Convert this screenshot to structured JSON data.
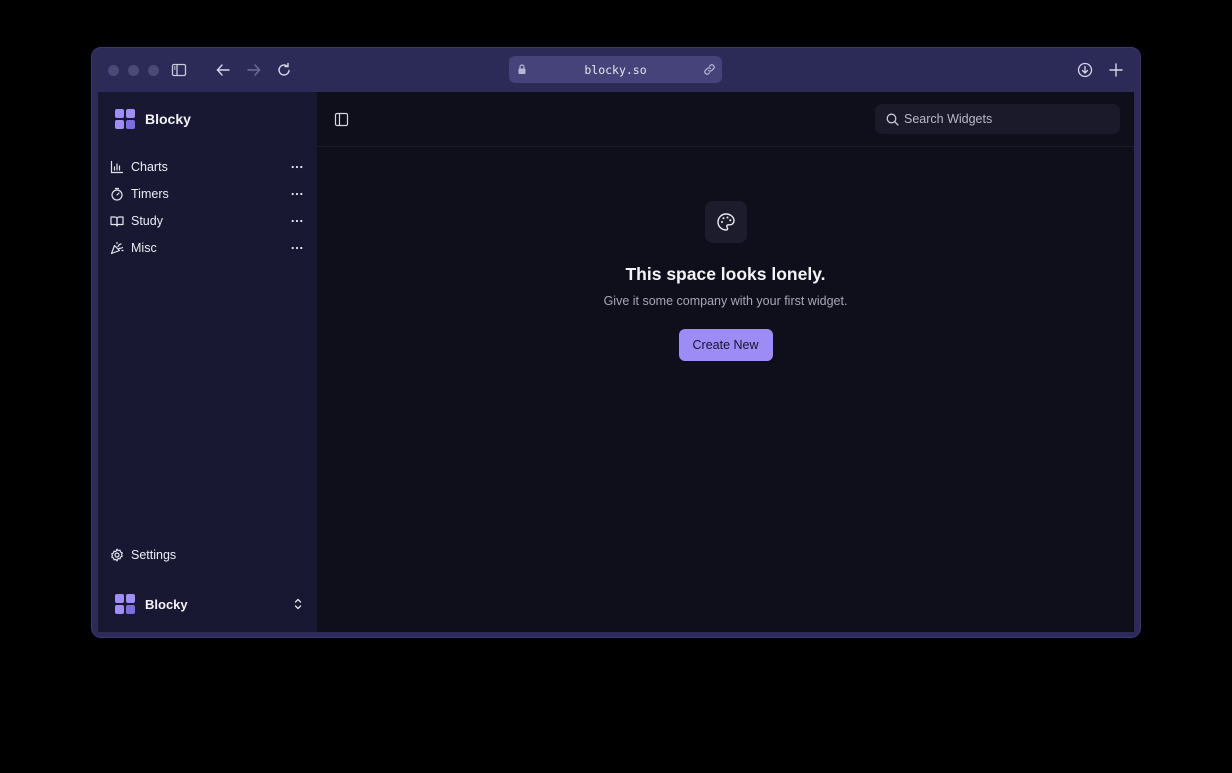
{
  "browser": {
    "url": "blocky.so",
    "icons": [
      "sidebar-toggle-icon",
      "back-arrow-icon",
      "forward-arrow-icon",
      "reload-icon",
      "lock-icon",
      "link-icon",
      "download-icon",
      "new-tab-icon"
    ]
  },
  "sidebar": {
    "brand": "Blocky",
    "items": [
      {
        "label": "Charts",
        "icon": "bar-chart-icon"
      },
      {
        "label": "Timers",
        "icon": "stopwatch-icon"
      },
      {
        "label": "Study",
        "icon": "open-book-icon"
      },
      {
        "label": "Misc",
        "icon": "party-popper-icon"
      }
    ],
    "settings_label": "Settings",
    "workspace_name": "Blocky"
  },
  "main": {
    "search_placeholder": "Search Widgets",
    "empty_title": "This space looks lonely.",
    "empty_subtitle": "Give it some company with your first widget.",
    "create_label": "Create New"
  },
  "colors": {
    "accent": "#9d8cf6",
    "sidebar_bg": "#181832",
    "main_bg": "#0f0f1b",
    "frame": "#2c2a57"
  }
}
